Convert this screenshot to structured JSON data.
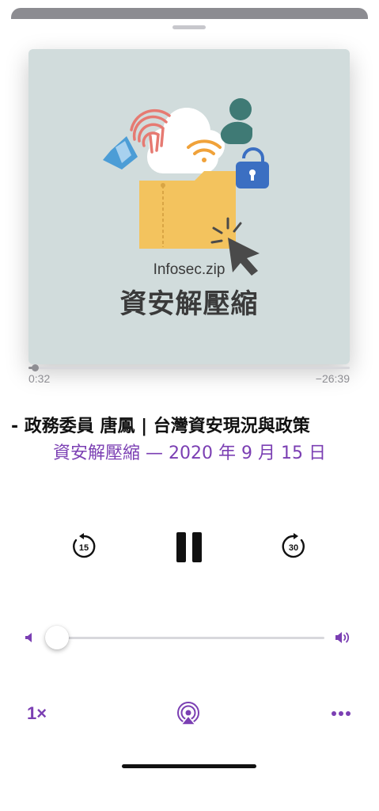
{
  "artwork": {
    "caption": "Infosec.zip",
    "title": "資安解壓縮"
  },
  "playback": {
    "progress_fraction": 0.02,
    "elapsed": "0:32",
    "remaining": "−26:39"
  },
  "episode": {
    "title": "- 政務委員 唐鳳 | 台灣資安現況與政策",
    "subtitle": "資安解壓縮 — 2020 年 9 月 15 日"
  },
  "controls": {
    "skip_back_seconds": "15",
    "skip_forward_seconds": "30",
    "state": "playing"
  },
  "volume": {
    "level_fraction": 0.0
  },
  "bottom_bar": {
    "speed_label": "1×",
    "airplay_icon": "airplay-icon",
    "more_icon": "ellipsis-icon"
  },
  "colors": {
    "accent": "#7b3fb3",
    "artwork_bg": "#d1dcdc",
    "folder": "#f3c35e"
  }
}
